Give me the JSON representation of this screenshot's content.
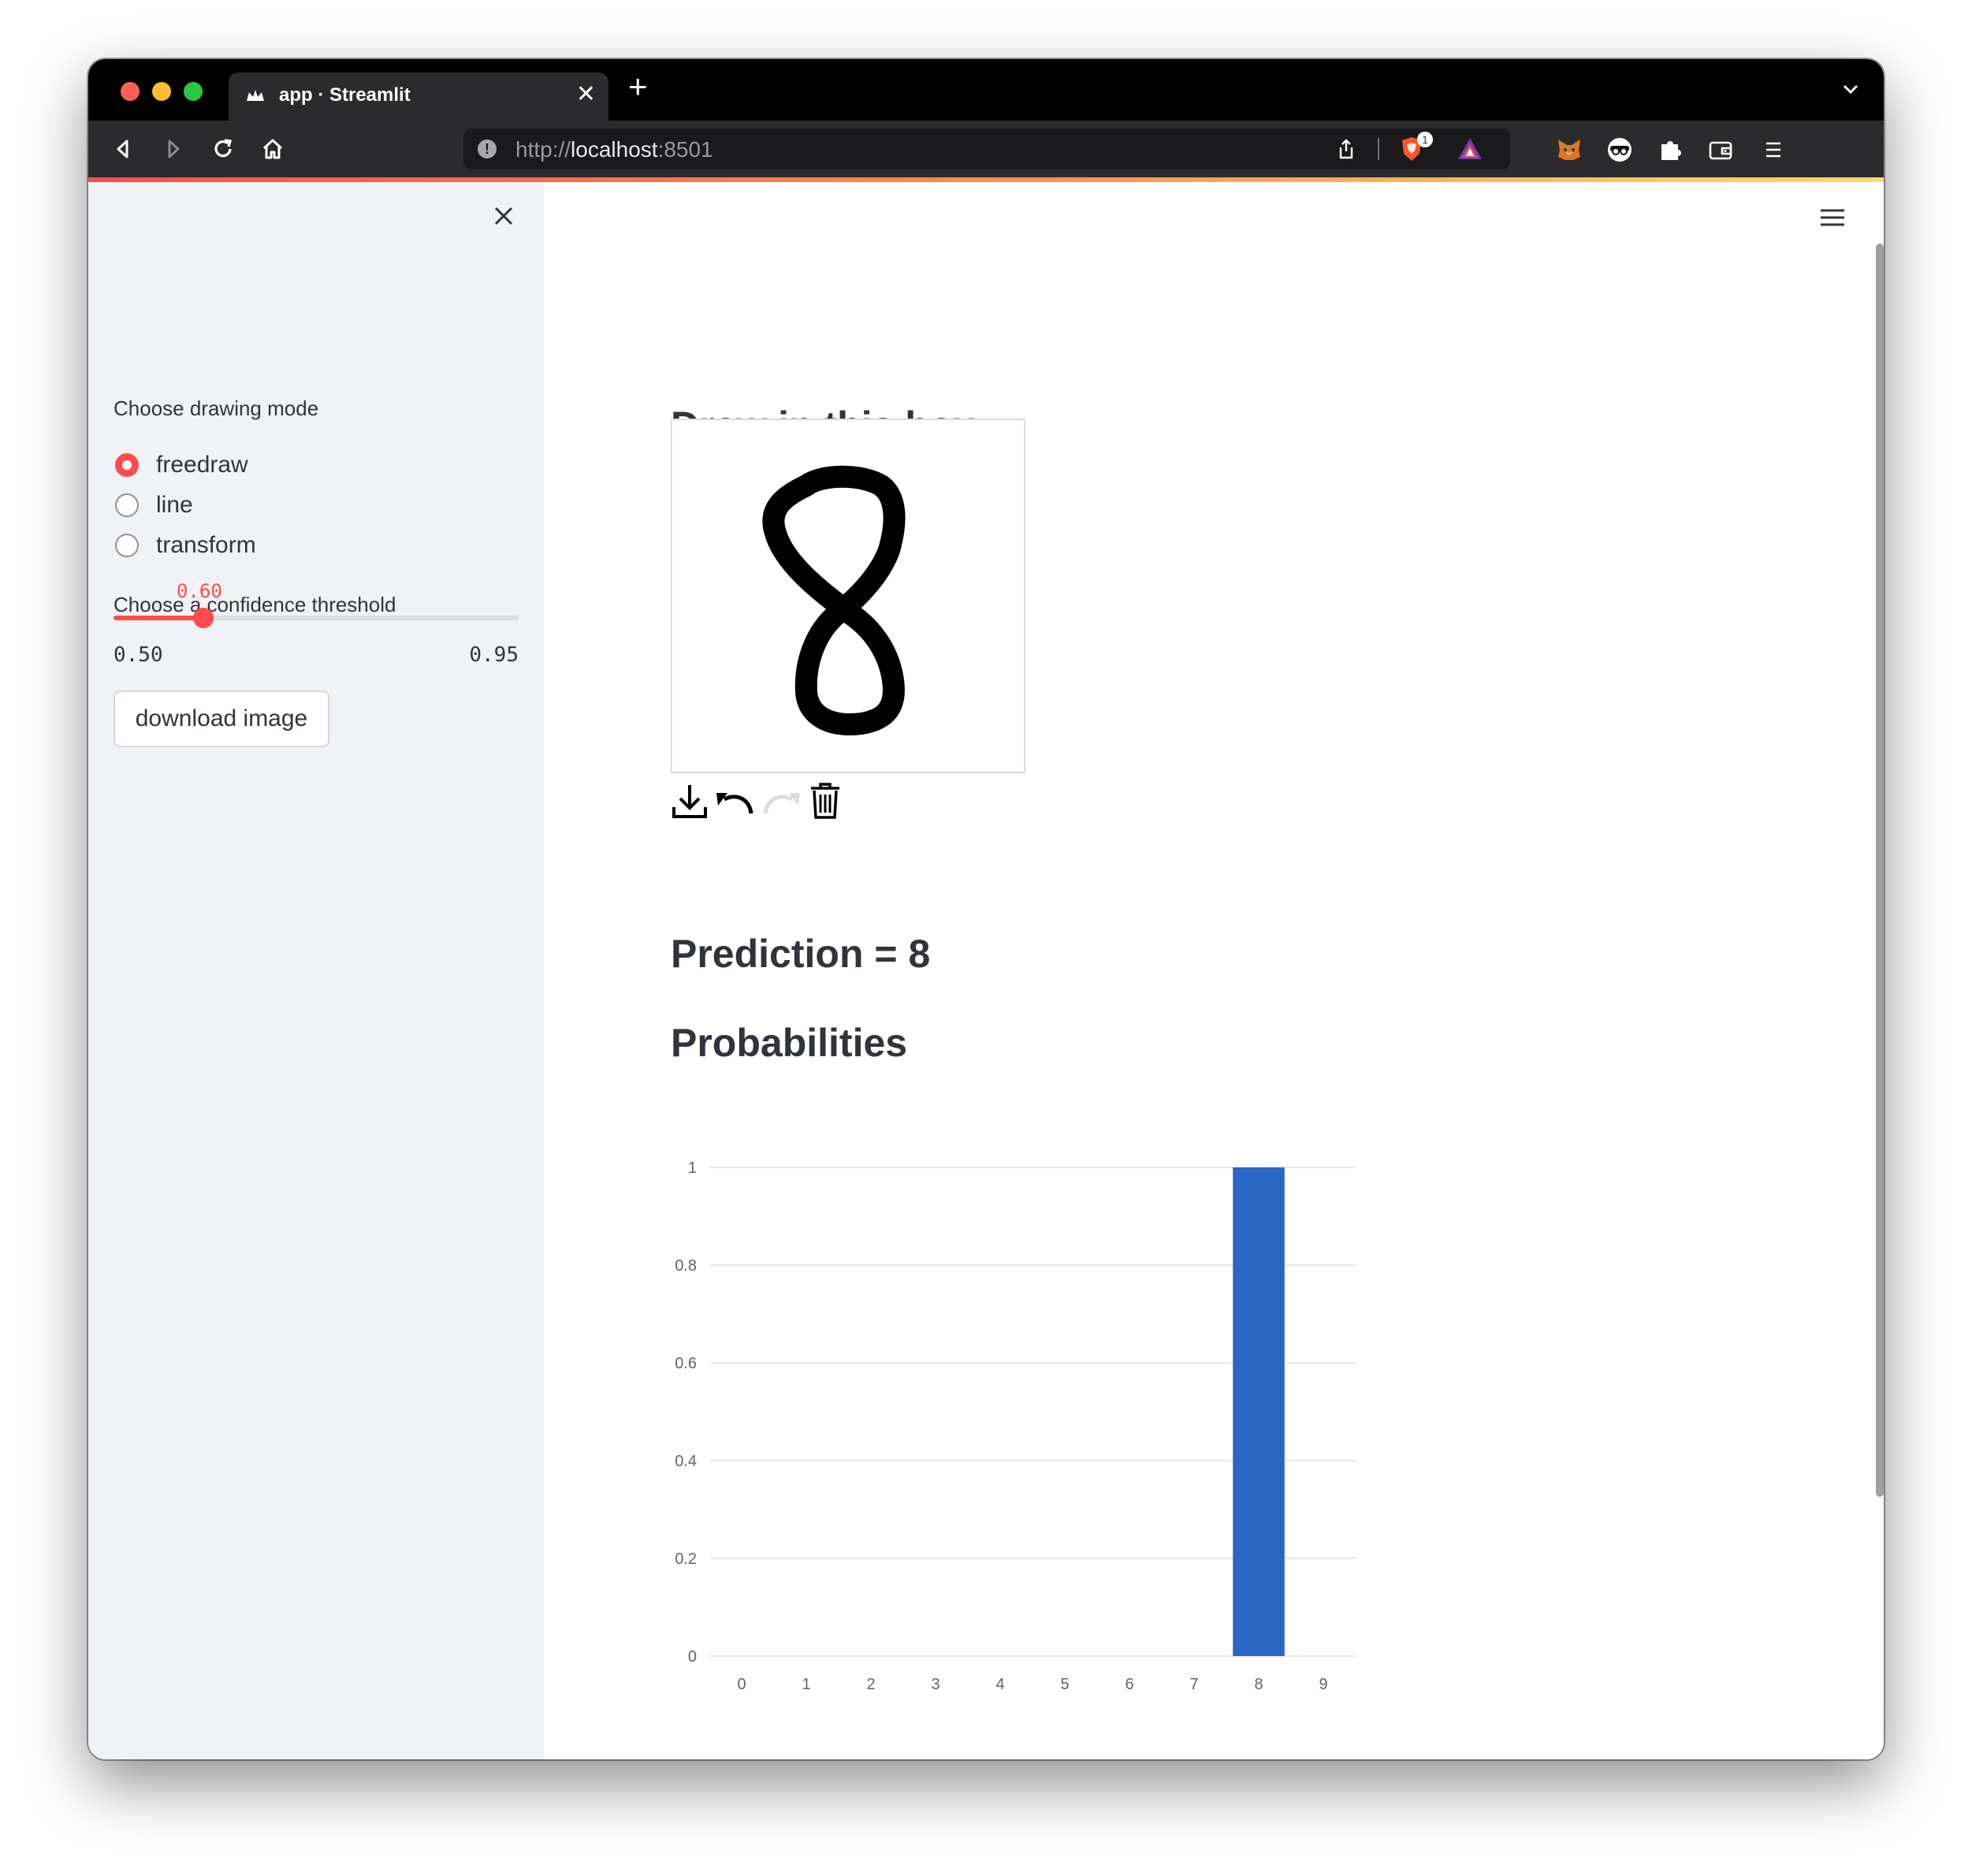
{
  "browser": {
    "tab_title": "app · Streamlit",
    "url_scheme": "http://",
    "url_host": "localhost",
    "url_port": ":8501",
    "brave_badge": "1"
  },
  "sidebar": {
    "drawing_mode_label": "Choose drawing mode",
    "drawing_modes": [
      {
        "label": "freedraw",
        "selected": true
      },
      {
        "label": "line",
        "selected": false
      },
      {
        "label": "transform",
        "selected": false
      }
    ],
    "threshold_label": "Choose a confidence threshold",
    "threshold_value": "0.60",
    "threshold_min": "0.50",
    "threshold_max": "0.95",
    "download_label": "download image"
  },
  "main": {
    "canvas_heading": "Draw in this box",
    "prediction_heading": "Prediction = 8",
    "probabilities_heading": "Probabilities"
  },
  "chart_data": {
    "type": "bar",
    "categories": [
      "0",
      "1",
      "2",
      "3",
      "4",
      "5",
      "6",
      "7",
      "8",
      "9"
    ],
    "values": [
      0,
      0,
      0,
      0,
      0,
      0,
      0,
      0,
      1,
      0
    ],
    "ylim": [
      0,
      1
    ],
    "yticks": [
      "0",
      "0.2",
      "0.4",
      "0.6",
      "0.8",
      "1"
    ],
    "bar_color": "#2a67c4",
    "grid": true,
    "title": "",
    "xlabel": "",
    "ylabel": ""
  },
  "colors": {
    "accent": "#ff4b4b",
    "sidebar_bg": "#f0f2f6",
    "text": "#31333f"
  }
}
